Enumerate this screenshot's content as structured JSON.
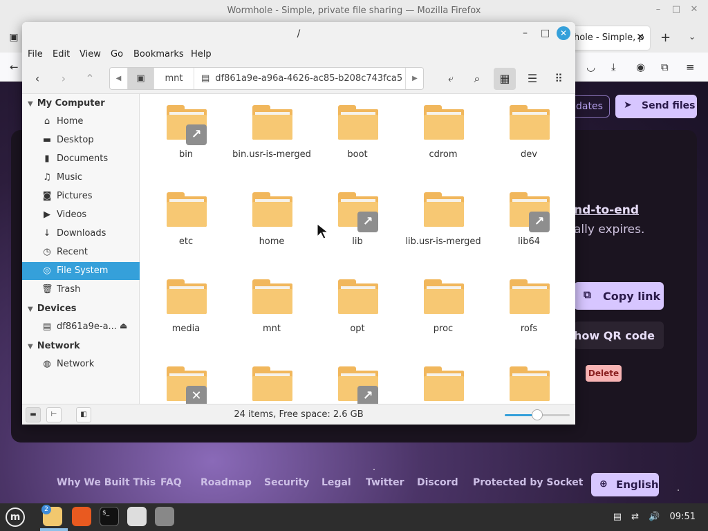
{
  "firefox": {
    "window_title": "Wormhole - Simple, private file sharing — Mozilla Firefox",
    "tab_title": "hole - Simple, p",
    "tab_close": "✕",
    "new_tab": "+"
  },
  "wormhole": {
    "updates_label": "dates",
    "send_label": "Send files",
    "line1": "nd-to-end",
    "line2": "ally expires.",
    "copy_label": "Copy link",
    "qr_label": "how QR code",
    "delete_label": "Delete",
    "footer_links": [
      "Why We Built This",
      "FAQ",
      "Roadmap",
      "Security",
      "Legal",
      "Twitter",
      "Discord",
      "Protected by Socket"
    ],
    "language_label": "English",
    "accent_color": "#d7c6ff"
  },
  "nemo": {
    "title": "/",
    "menu": [
      "File",
      "Edit",
      "View",
      "Go",
      "Bookmarks",
      "Help"
    ],
    "path": [
      "mnt",
      "df861a9e-a96a-4626-ac85-b208c743fca5"
    ],
    "sidebar": {
      "sections": [
        {
          "heading": "My Computer",
          "items": [
            {
              "label": "Home",
              "icon": "home-icon"
            },
            {
              "label": "Desktop",
              "icon": "desktop-icon"
            },
            {
              "label": "Documents",
              "icon": "documents-icon"
            },
            {
              "label": "Music",
              "icon": "music-icon"
            },
            {
              "label": "Pictures",
              "icon": "pictures-icon"
            },
            {
              "label": "Videos",
              "icon": "videos-icon"
            },
            {
              "label": "Downloads",
              "icon": "downloads-icon"
            },
            {
              "label": "Recent",
              "icon": "recent-icon"
            },
            {
              "label": "File System",
              "icon": "filesystem-icon",
              "selected": true
            },
            {
              "label": "Trash",
              "icon": "trash-icon"
            }
          ]
        },
        {
          "heading": "Devices",
          "items": [
            {
              "label": "df861a9e-a...",
              "icon": "drive-icon"
            }
          ]
        },
        {
          "heading": "Network",
          "items": [
            {
              "label": "Network",
              "icon": "network-icon"
            }
          ]
        }
      ]
    },
    "files": [
      {
        "name": "bin",
        "emblem": "link"
      },
      {
        "name": "bin.usr-is-merged",
        "emblem": ""
      },
      {
        "name": "boot",
        "emblem": ""
      },
      {
        "name": "cdrom",
        "emblem": ""
      },
      {
        "name": "dev",
        "emblem": ""
      },
      {
        "name": "etc",
        "emblem": ""
      },
      {
        "name": "home",
        "emblem": ""
      },
      {
        "name": "lib",
        "emblem": "link"
      },
      {
        "name": "lib.usr-is-merged",
        "emblem": ""
      },
      {
        "name": "lib64",
        "emblem": "link"
      },
      {
        "name": "media",
        "emblem": ""
      },
      {
        "name": "mnt",
        "emblem": ""
      },
      {
        "name": "opt",
        "emblem": ""
      },
      {
        "name": "proc",
        "emblem": ""
      },
      {
        "name": "rofs",
        "emblem": ""
      },
      {
        "name": "",
        "emblem": "broken"
      },
      {
        "name": "",
        "emblem": ""
      },
      {
        "name": "",
        "emblem": "link"
      },
      {
        "name": "",
        "emblem": ""
      },
      {
        "name": "",
        "emblem": ""
      }
    ],
    "status_text": "24 items, Free space: 2.6 GB",
    "zoom_level": 0.5,
    "selection_color": "#35a0da"
  },
  "taskbar": {
    "workspace_badge": "2",
    "clock": "09:51"
  }
}
